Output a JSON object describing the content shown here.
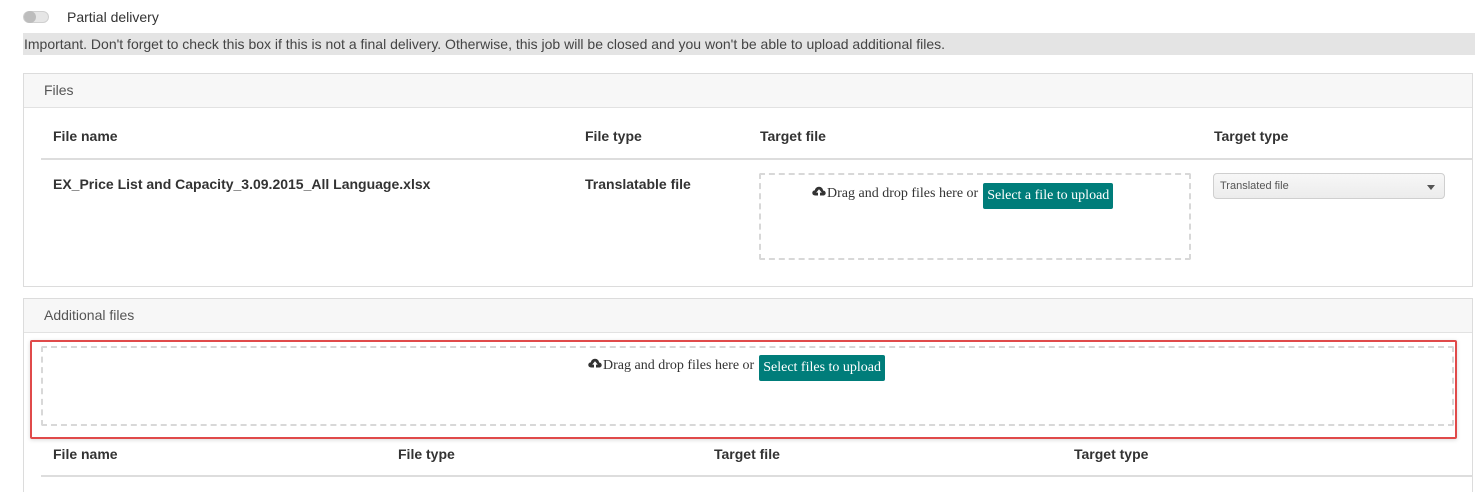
{
  "partial_delivery": {
    "label": "Partial delivery",
    "enabled": false
  },
  "notice": {
    "text": "Important. Don't forget to check this box if this is not a final delivery. Otherwise, this job will be closed and you won't be able to upload additional files."
  },
  "files_panel": {
    "heading": "Files",
    "columns": {
      "file_name": "File name",
      "file_type": "File type",
      "target_file": "Target file",
      "target_type": "Target type"
    },
    "rows": [
      {
        "file_name": "EX_Price List and Capacity_3.09.2015_All Language.xlsx",
        "file_type": "Translatable file",
        "dropzone_text": "Drag and drop files here or",
        "upload_button": "Select a file to upload",
        "target_type_selected": "Translated file"
      }
    ]
  },
  "additional_panel": {
    "heading": "Additional files",
    "dropzone_text": "Drag and drop files here or",
    "upload_button": "Select files to upload",
    "columns": {
      "file_name": "File name",
      "file_type": "File type",
      "target_file": "Target file",
      "target_type": "Target type"
    }
  },
  "colors": {
    "accent": "#007d7a",
    "highlight": "#e04a4a",
    "notice_bg": "#e4e4e4"
  },
  "icons": {
    "upload": "cloud-upload-icon",
    "dropdown": "chevron-down-icon"
  }
}
